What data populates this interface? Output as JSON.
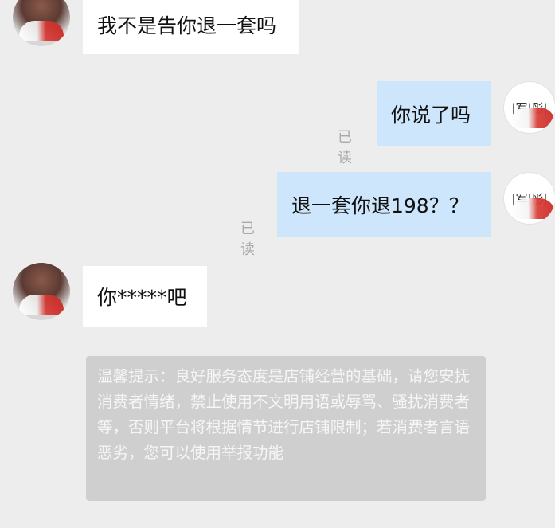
{
  "messages": [
    {
      "side": "in",
      "text": "我不是告你退一套吗"
    },
    {
      "side": "out",
      "text": "你说了吗",
      "status": "已读"
    },
    {
      "side": "out",
      "text": "退一套你退198？？",
      "status": "已读"
    },
    {
      "side": "in",
      "text": "你*****吧"
    }
  ],
  "my_avatar_label": "|军|彤|",
  "notice": {
    "text": "温馨提示：良好服务态度是店铺经营的基础，请您安抚消费者情绪，禁止使用不文明用语或辱骂、骚扰消费者等，否则平台将根据情节进行店铺限制；若消费者言语恶劣，您可以使用举报功能"
  },
  "colors": {
    "background": "#ededed",
    "incoming_bubble": "#ffffff",
    "outgoing_bubble": "#cde6fb",
    "notice_bg": "#cfcfcf",
    "read_status": "#a9a9a9"
  }
}
